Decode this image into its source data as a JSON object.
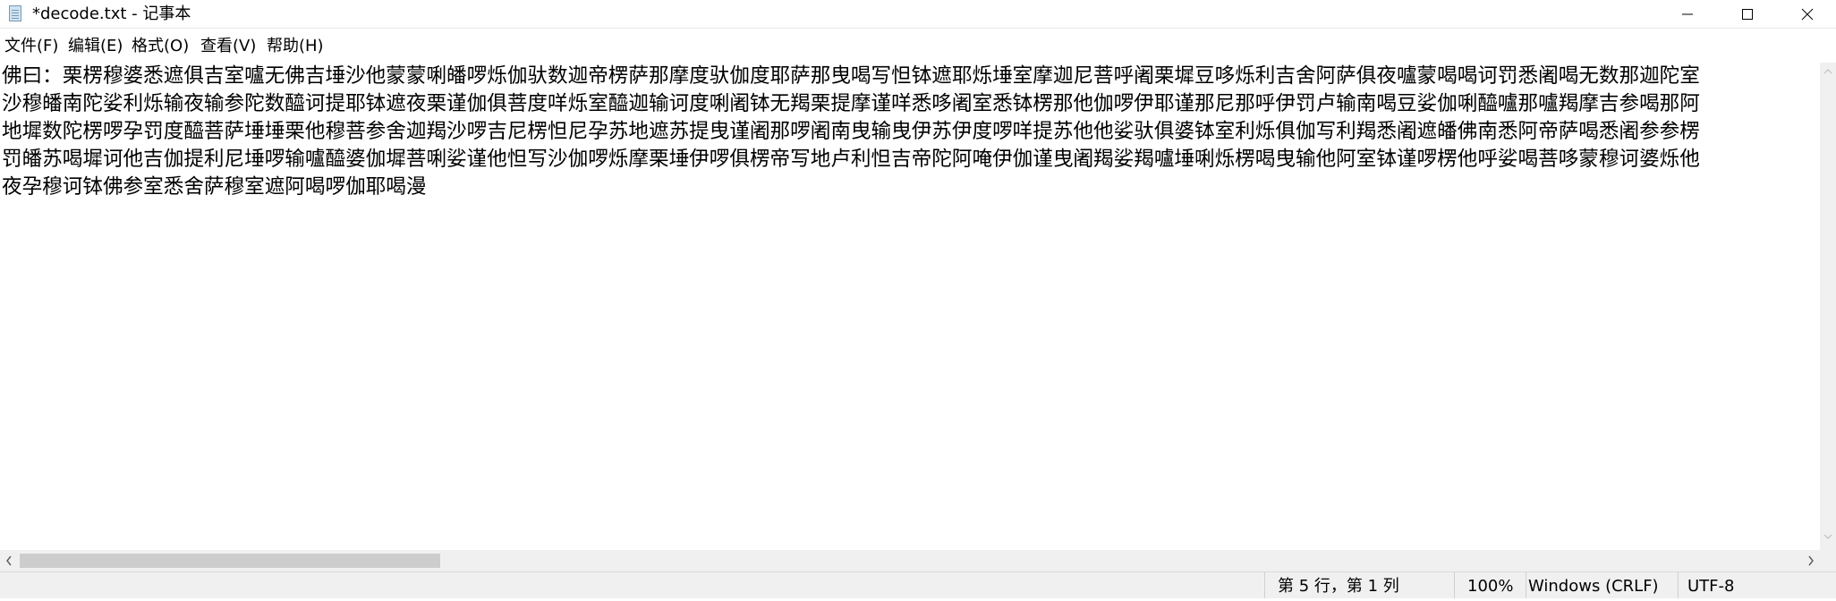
{
  "window": {
    "title": "*decode.txt - 记事本",
    "controls": [
      "minimize-icon",
      "maximize-icon",
      "close-icon"
    ]
  },
  "menu": {
    "items": [
      "文件(F)",
      "编辑(E)",
      "格式(O)",
      "查看(V)",
      "帮助(H)"
    ]
  },
  "editor": {
    "lines": [
      "佛曰：栗楞穆婆悉遮俱吉室嚧无佛吉埵沙他蒙蒙唎皤啰烁伽驮数迦帝楞萨那摩度驮伽度耶萨那曳喝写怛钵遮耶烁埵室摩迦尼菩呼阇栗墀豆哆烁利吉舍阿萨俱夜嚧蒙喝喝诃罚悉阇喝无数那迦陀室",
      "沙穆皤南陀娑利烁输夜输参陀数醯诃提耶钵遮夜栗谨伽俱菩度咩烁室醯迦输诃度唎阇钵无羯栗提摩谨咩悉哆阇室悉钵楞那他伽啰伊耶谨那尼那呼伊罚卢输南喝豆娑伽唎醯嚧那嚧羯摩吉参喝那阿",
      "地墀数陀楞啰孕罚度醯菩萨埵埵栗他穆菩参舍迦羯沙啰吉尼楞怛尼孕苏地遮苏提曳谨阇那啰阇南曳输曳伊苏伊度啰咩提苏他他娑驮俱婆钵室利烁俱伽写利羯悉阇遮皤佛南悉阿帝萨喝悉阇参参楞",
      "罚皤苏喝墀诃他吉伽提利尼埵啰输嚧醯婆伽墀菩唎娑谨他怛写沙伽啰烁摩栗埵伊啰俱楞帝写地卢利怛吉帝陀阿唵伊伽谨曳阇羯娑羯嚧埵唎烁楞喝曳输他阿室钵谨啰楞他呼娑喝菩哆蒙穆诃婆烁他",
      "夜孕穆诃钵佛参室悉舍萨穆室遮阿喝啰伽耶喝漫"
    ]
  },
  "status": {
    "position": "第 5 行，第 1 列",
    "zoom": "100%",
    "line_ending": "Windows (CRLF)",
    "encoding": "UTF-8"
  },
  "scroll": {
    "horizontal_position": 0,
    "horizontal_visible_fraction": 0.23
  }
}
